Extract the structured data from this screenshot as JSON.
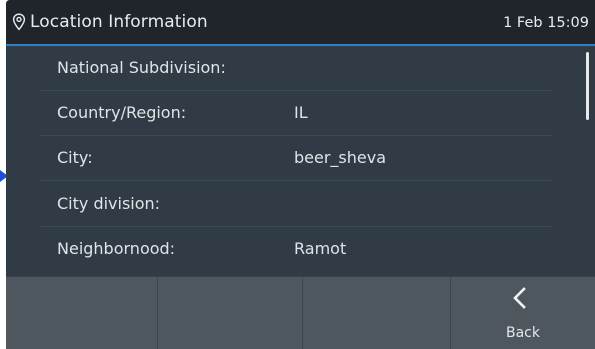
{
  "header": {
    "icon": "location-pin-icon",
    "title": "Location Information",
    "datetime": "1 Feb 15:09"
  },
  "rows": [
    {
      "label": "National Subdivision:",
      "value": ""
    },
    {
      "label": "Country/Region:",
      "value": "IL"
    },
    {
      "label": "City:",
      "value": "beer_sheva"
    },
    {
      "label": "City division:",
      "value": ""
    },
    {
      "label": "Neighbornood:",
      "value": "Ramot"
    }
  ],
  "softkeys": {
    "back_icon": "chevron-left-icon",
    "back_label": "Back"
  },
  "colors": {
    "header_bg": "#1f252b",
    "accent": "#2f7fc3",
    "list_bg": "#313b45",
    "softkey_bg": "#4e565e",
    "pointer_arrow": "#1b4fd6"
  }
}
